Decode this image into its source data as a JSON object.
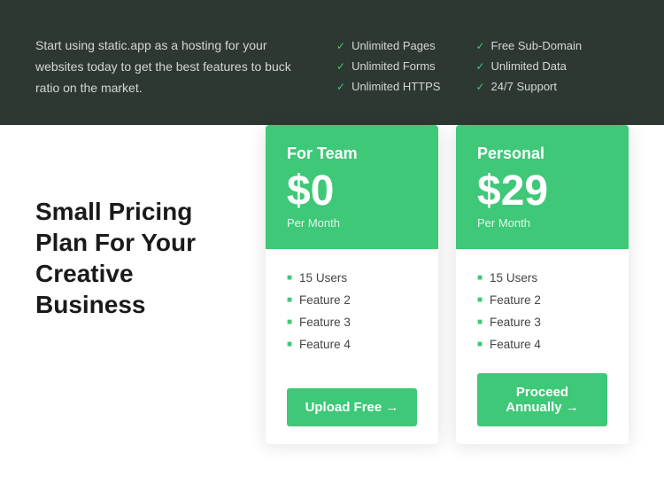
{
  "top": {
    "description": "Start using static.app as a hosting for your websites today to get the best features to buck ratio on the market.",
    "features_col1": [
      {
        "label": "Unlimited Pages"
      },
      {
        "label": "Unlimited Forms"
      },
      {
        "label": "Unlimited HTTPS"
      }
    ],
    "features_col2": [
      {
        "label": "Free Sub-Domain"
      },
      {
        "label": "Unlimited Data"
      },
      {
        "label": "24/7 Support"
      }
    ]
  },
  "bottom": {
    "heading": "Small Pricing Plan For Your Creative Business"
  },
  "cards": [
    {
      "title": "For Team",
      "price": "$0",
      "period": "Per Month",
      "features": [
        "15 Users",
        "Feature 2",
        "Feature 3",
        "Feature 4"
      ],
      "button_label": "Upload Free →"
    },
    {
      "title": "Personal",
      "price": "$29",
      "period": "Per Month",
      "features": [
        "15 Users",
        "Feature 2",
        "Feature 3",
        "Feature 4"
      ],
      "button_label": "Proceed Annually →"
    }
  ]
}
